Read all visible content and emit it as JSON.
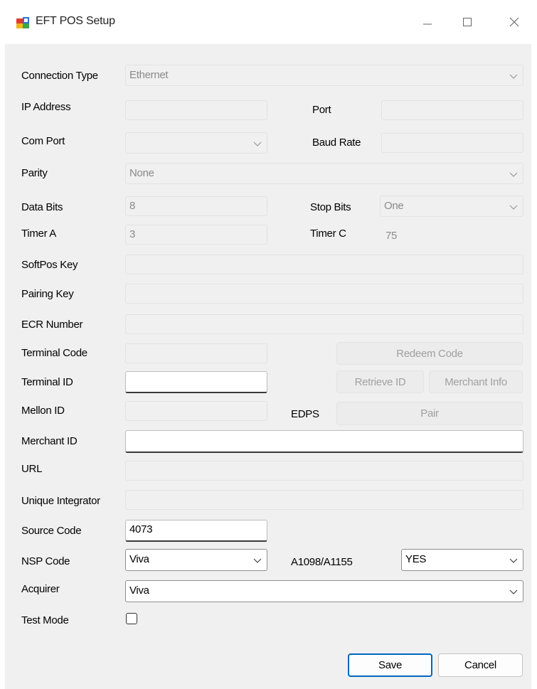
{
  "window": {
    "title": "EFT POS Setup",
    "minimize_icon": "minimize-icon",
    "maximize_icon": "maximize-icon",
    "close_icon": "close-icon"
  },
  "form": {
    "connection_type": {
      "label": "Connection Type",
      "value": "Ethernet"
    },
    "ip_address": {
      "label": "IP Address",
      "value": ""
    },
    "port": {
      "label": "Port",
      "value": ""
    },
    "com_port": {
      "label": "Com Port",
      "value": ""
    },
    "baud_rate": {
      "label": "Baud Rate",
      "value": ""
    },
    "parity": {
      "label": "Parity",
      "value": "None"
    },
    "data_bits": {
      "label": "Data Bits",
      "value": "8"
    },
    "stop_bits": {
      "label": "Stop Bits",
      "value": "One"
    },
    "timer_a": {
      "label": "Timer A",
      "value": "3"
    },
    "timer_c": {
      "label": "Timer C",
      "value": "75"
    },
    "softpos_key": {
      "label": "SoftPos Key",
      "value": ""
    },
    "pairing_key": {
      "label": "Pairing Key",
      "value": ""
    },
    "ecr_number": {
      "label": "ECR Number",
      "value": ""
    },
    "terminal_code": {
      "label": "Terminal Code",
      "value": ""
    },
    "redeem_code_button": "Redeem Code",
    "terminal_id": {
      "label": "Terminal ID",
      "value": ""
    },
    "retrieve_id_button": "Retrieve ID",
    "merchant_info_button": "Merchant Info",
    "mellon_id": {
      "label": "Mellon ID",
      "value": ""
    },
    "edps_label": "EDPS",
    "pair_button": "Pair",
    "merchant_id": {
      "label": "Merchant ID",
      "value": ""
    },
    "url": {
      "label": "URL",
      "value": ""
    },
    "unique_integrator": {
      "label": "Unique Integrator",
      "value": ""
    },
    "source_code": {
      "label": "Source Code",
      "value": "4073"
    },
    "nsp_code": {
      "label": "NSP Code",
      "value": "Viva"
    },
    "a1098": {
      "label": "A1098/A1155",
      "value": "YES"
    },
    "acquirer": {
      "label": "Acquirer",
      "value": "Viva"
    },
    "test_mode": {
      "label": "Test Mode",
      "checked": false
    }
  },
  "footer": {
    "save_label": "Save",
    "cancel_label": "Cancel"
  },
  "colors": {
    "accent": "#0067c0",
    "client_background": "#f0f0f0"
  }
}
